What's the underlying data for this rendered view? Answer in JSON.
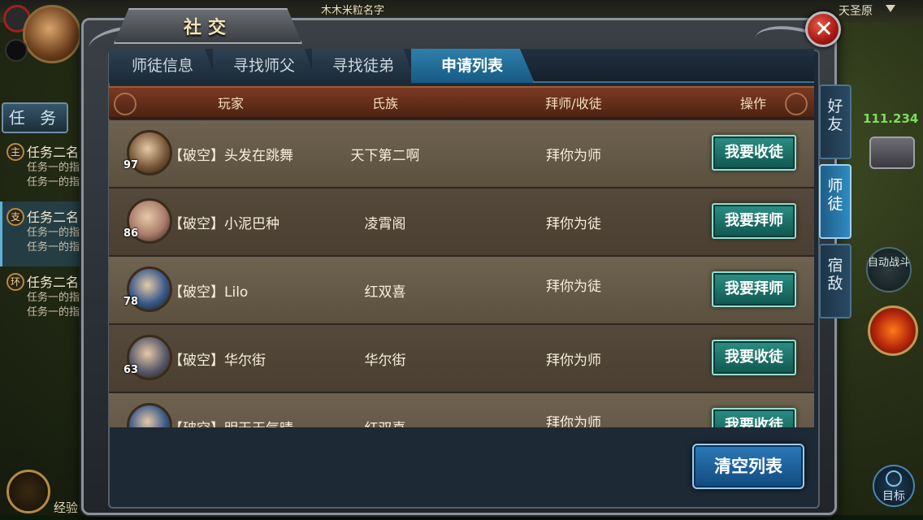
{
  "hud": {
    "top_name": "木木米粒名字",
    "region": "天圣原",
    "task_tab": "任 务",
    "tasks": [
      {
        "badge": "主",
        "title": "任务二名",
        "line1": "任务一的指",
        "line2": "任务一的指"
      },
      {
        "badge": "支",
        "title": "任务二名",
        "line1": "任务一的指",
        "line2": "任务一的指"
      },
      {
        "badge": "环",
        "title": "任务二名",
        "line1": "任务一的指",
        "line2": "任务一的指"
      }
    ],
    "money": "111.234",
    "auto_battle": "自动战斗",
    "target": "目标",
    "exp": "经验"
  },
  "panel": {
    "title": "社交",
    "close_glyph": "✕",
    "tabs": [
      "师徒信息",
      "寻找师父",
      "寻找徒弟",
      "申请列表"
    ],
    "active_tab": "申请列表",
    "columns": [
      "玩家",
      "氏族",
      "拜师/收徒",
      "操作"
    ],
    "rows": [
      {
        "level": "97",
        "player": "【破空】头发在跳舞",
        "clan": "天下第二啊",
        "relation": "拜你为师",
        "action": "我要收徒",
        "avatar_color": "#7a5a3a"
      },
      {
        "level": "86",
        "player": "【破空】小泥巴种",
        "clan": "凌霄阁",
        "relation": "拜你为徒",
        "action": "我要拜师",
        "avatar_color": "#a97b6a"
      },
      {
        "level": "78",
        "player": "【破空】Lilo",
        "clan": "红双喜",
        "relation": "拜你为徒",
        "action": "我要拜师",
        "avatar_color": "#3a5a8a"
      },
      {
        "level": "63",
        "player": "【破空】华尔街",
        "clan": "华尔街",
        "relation": "拜你为师",
        "action": "我要收徒",
        "avatar_color": "#5a5a6a"
      },
      {
        "level": "",
        "player": "【破空】明天天气晴",
        "clan": "红双喜",
        "relation": "拜你为师",
        "action": "我要收徒",
        "avatar_color": "#3a5a8a"
      }
    ],
    "side_tabs": [
      "好友",
      "师徒",
      "宿敌"
    ],
    "active_side_tab": "师徒",
    "clear_button": "清空列表"
  }
}
